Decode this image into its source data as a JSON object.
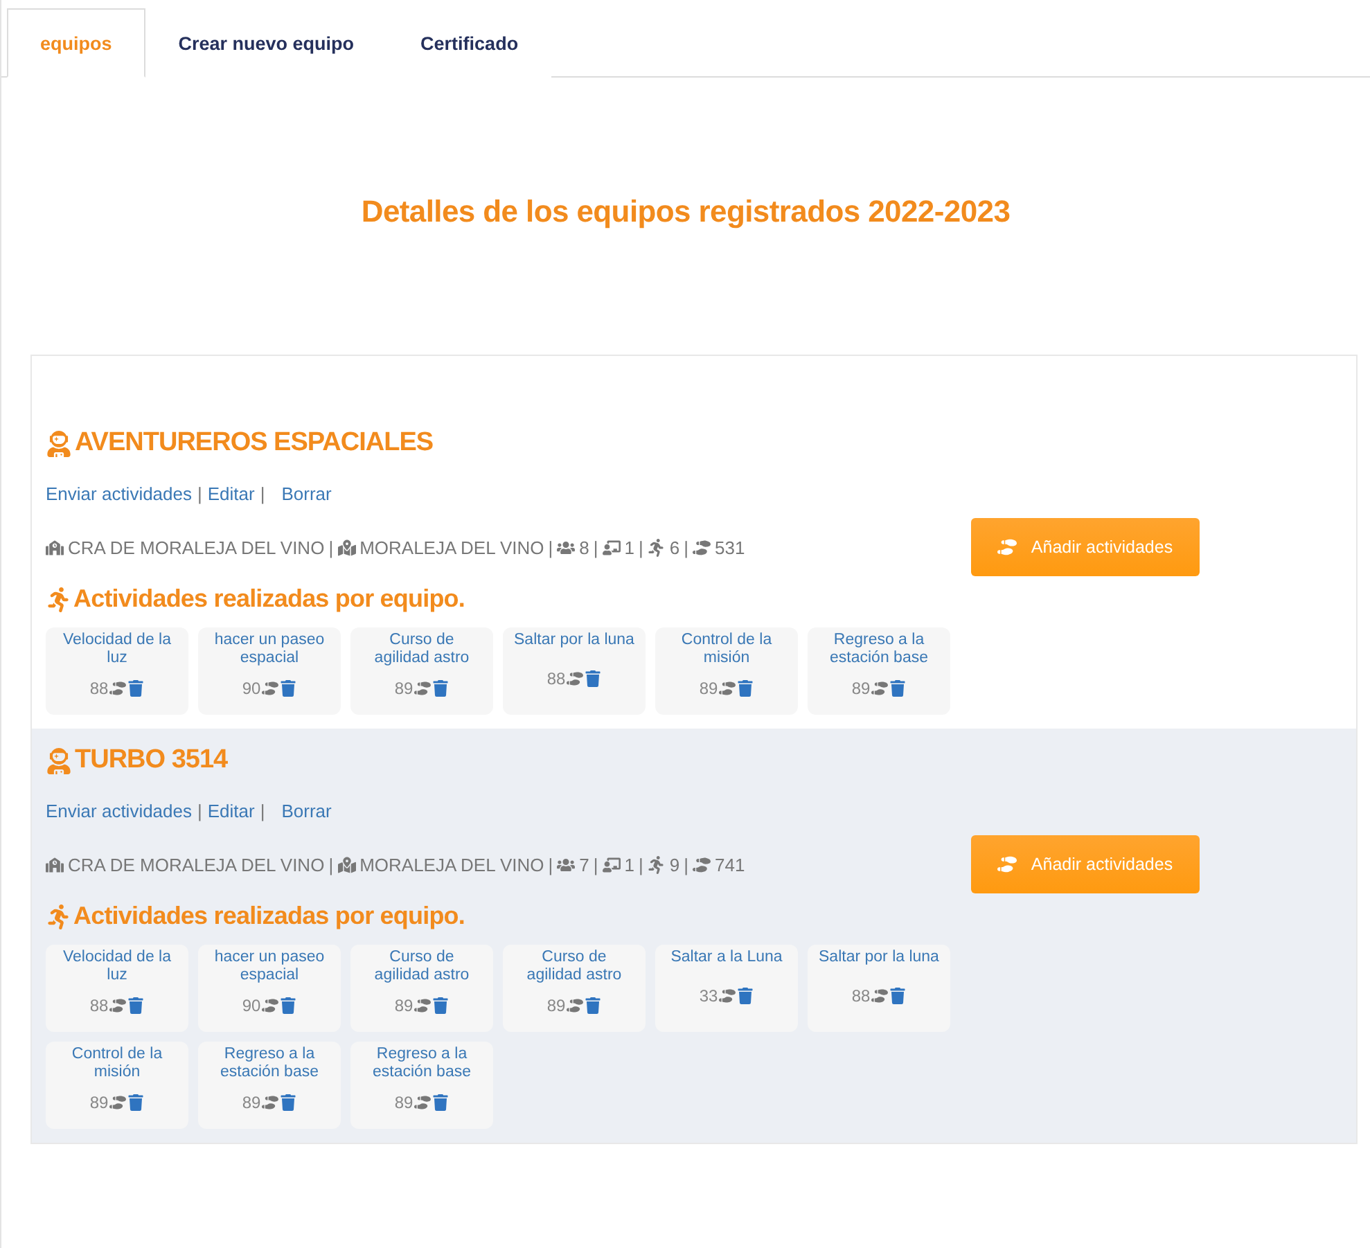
{
  "tabs": [
    {
      "label": "equipos",
      "selected": true
    },
    {
      "label": "Crear nuevo equipo",
      "selected": false
    },
    {
      "label": "Certificado",
      "selected": false
    }
  ],
  "heading": "Detalles de los equipos registrados 2022-2023",
  "teams": [
    {
      "name": "AVENTUREROS ESPACIALES",
      "separator": "|",
      "links": [
        "Enviar actividades",
        "Editar",
        "Borrar"
      ],
      "school": "CRA DE MORALEJA DEL VINO",
      "town": "MORALEJA DEL VINO",
      "members": "8",
      "teachers": "1",
      "activity_count": "6",
      "steps": "531",
      "button": "Añadir actividades",
      "section_title": "Actividades realizadas por equipo.",
      "activities": [
        {
          "name": "Velocidad de la luz",
          "score": "88"
        },
        {
          "name": "hacer un paseo espacial",
          "score": "90"
        },
        {
          "name": "Curso de agilidad astro",
          "score": "89"
        },
        {
          "name": "Saltar por la luna",
          "score": "88"
        },
        {
          "name": "Control de la misión",
          "score": "89"
        },
        {
          "name": "Regreso a la estación base",
          "score": "89"
        }
      ]
    },
    {
      "name": "TURBO 3514",
      "separator": "|",
      "links": [
        "Enviar actividades",
        "Editar",
        "Borrar"
      ],
      "school": "CRA DE MORALEJA DEL VINO",
      "town": "MORALEJA DEL VINO",
      "members": "7",
      "teachers": "1",
      "activity_count": "9",
      "steps": "741",
      "button": "Añadir actividades",
      "section_title": "Actividades realizadas por equipo.",
      "activities": [
        {
          "name": "Velocidad de la luz",
          "score": "88"
        },
        {
          "name": "hacer un paseo espacial",
          "score": "90"
        },
        {
          "name": "Curso de agilidad astro",
          "score": "89"
        },
        {
          "name": "Curso de agilidad astro",
          "score": "89"
        },
        {
          "name": "Saltar a la Luna",
          "score": "33"
        },
        {
          "name": "Saltar por la luna",
          "score": "88"
        },
        {
          "name": "Control de la misión",
          "score": "89"
        },
        {
          "name": "Regreso a la estación base",
          "score": "89"
        },
        {
          "name": "Regreso a la estación base",
          "score": "89"
        }
      ]
    }
  ]
}
